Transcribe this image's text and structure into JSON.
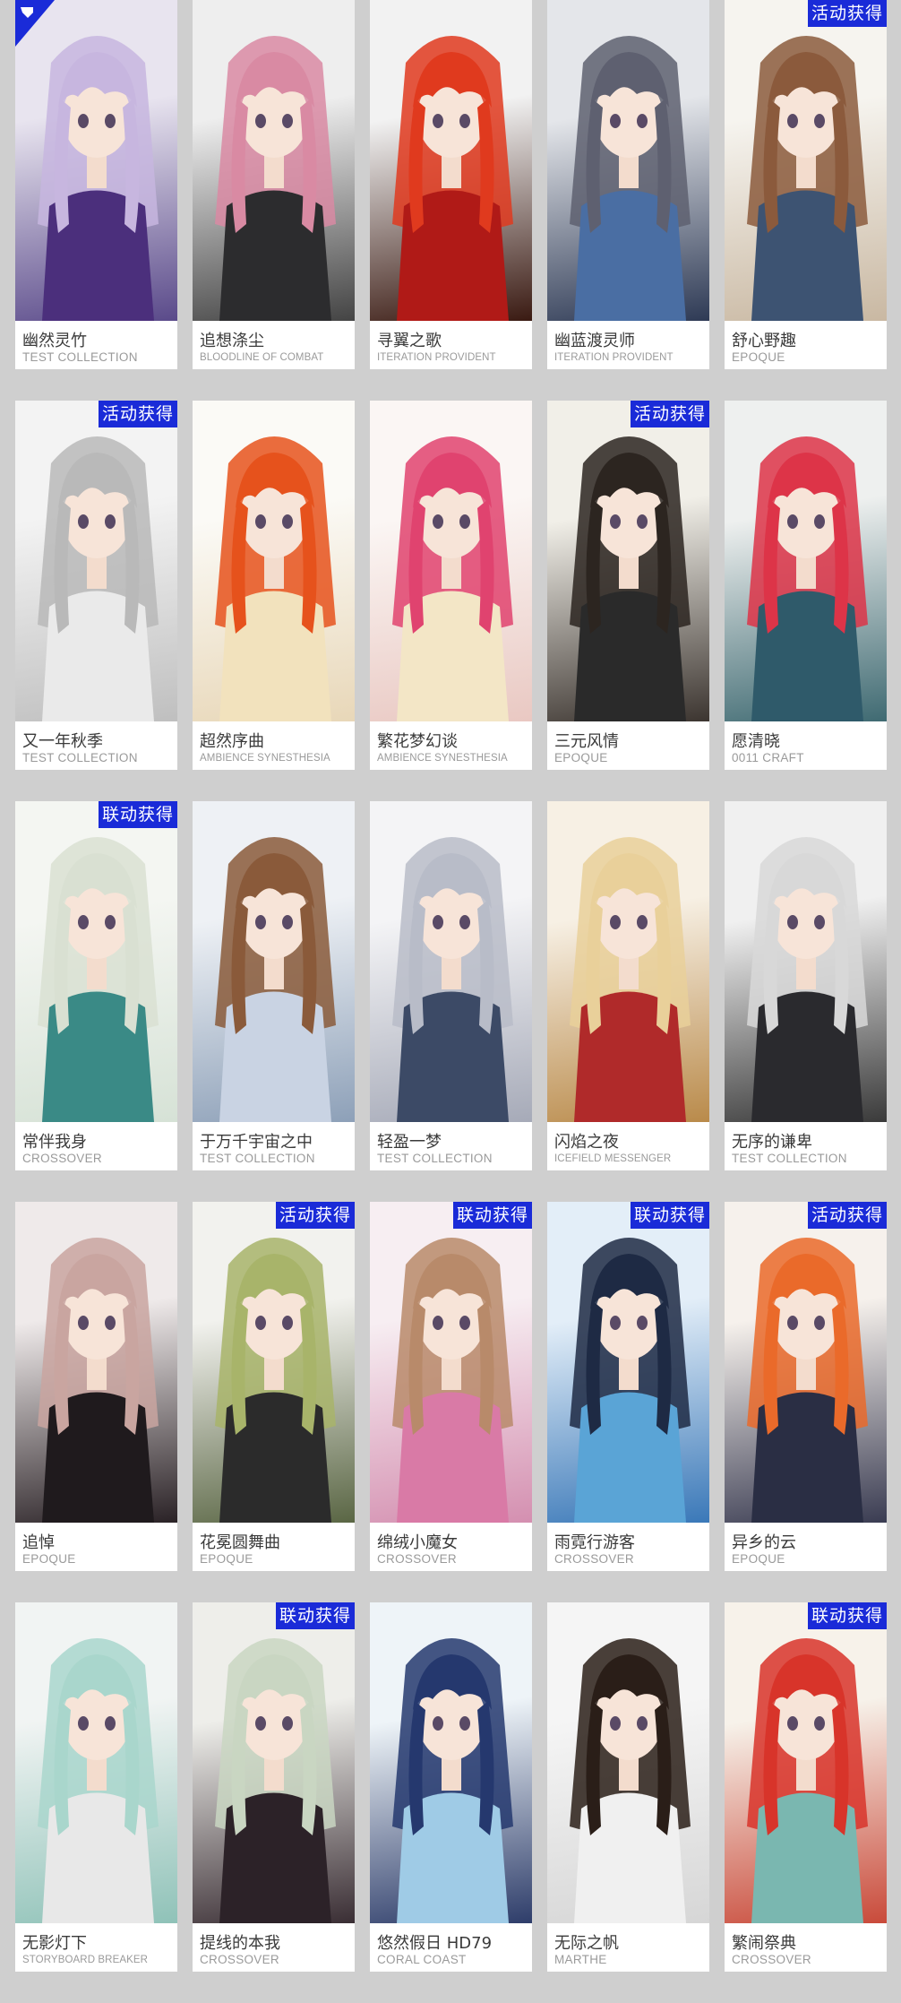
{
  "cards": [
    {
      "name": "幽然灵竹",
      "series": "TEST COLLECTION",
      "badge": "",
      "bg": [
        "#e8e4ef",
        "#5a4a8a"
      ],
      "hair": "#c7b6df",
      "outfit": "#4b2f7c",
      "corner_icon": "crest-icon"
    },
    {
      "name": "追想涤尘",
      "series": "BLOODLINE OF COMBAT",
      "badge": "",
      "bg": [
        "#eeeeee",
        "#444444"
      ],
      "hair": "#d98aa3",
      "outfit": "#2c2c2e"
    },
    {
      "name": "寻翼之歌",
      "series": "ITERATION PROVIDENT",
      "badge": "",
      "bg": [
        "#f2f2f2",
        "#3a1a12"
      ],
      "hair": "#e03a1e",
      "outfit": "#b01a17"
    },
    {
      "name": "幽蓝渡灵师",
      "series": "ITERATION PROVIDENT",
      "badge": "",
      "bg": [
        "#e4e6ea",
        "#2e3a55"
      ],
      "hair": "#5e6070",
      "outfit": "#4a6ea3"
    },
    {
      "name": "舒心野趣",
      "series": "EPOQUE",
      "badge": "活动获得",
      "bg": [
        "#f6f4ef",
        "#c9b8a2"
      ],
      "hair": "#8b5a3c",
      "outfit": "#3d5372"
    },
    {
      "name": "又一年秋季",
      "series": "TEST COLLECTION",
      "badge": "活动获得",
      "bg": [
        "#f3f3f3",
        "#bfbfbf"
      ],
      "hair": "#b9b9b9",
      "outfit": "#eaeaea"
    },
    {
      "name": "超然序曲",
      "series": "AMBIENCE SYNESTHESIA",
      "badge": "",
      "bg": [
        "#fbfaf6",
        "#e8d7b8"
      ],
      "hair": "#e6521c",
      "outfit": "#f2e2bd"
    },
    {
      "name": "繁花梦幻谈",
      "series": "AMBIENCE SYNESTHESIA",
      "badge": "",
      "bg": [
        "#fbf6f4",
        "#e9c8c2"
      ],
      "hair": "#e0436f",
      "outfit": "#f3e6c6"
    },
    {
      "name": "三元风情",
      "series": "EPOQUE",
      "badge": "活动获得",
      "bg": [
        "#f1efe8",
        "#3c3530"
      ],
      "hair": "#2c2520",
      "outfit": "#2a2a2a"
    },
    {
      "name": "愿清晓",
      "series": "0011 CRAFT",
      "badge": "",
      "bg": [
        "#eef0ef",
        "#3f6a72"
      ],
      "hair": "#dd3448",
      "outfit": "#2f5a6a"
    },
    {
      "name": "常伴我身",
      "series": "CROSSOVER",
      "badge": "联动获得",
      "bg": [
        "#f4f6f2",
        "#d6e2d6"
      ],
      "hair": "#d9e0d2",
      "outfit": "#3a8a86"
    },
    {
      "name": "于万千宇宙之中",
      "series": "TEST COLLECTION",
      "badge": "",
      "bg": [
        "#eef1f5",
        "#8da0b8"
      ],
      "hair": "#8a5a3a",
      "outfit": "#c9d3e3"
    },
    {
      "name": "轻盈一梦",
      "series": "TEST COLLECTION",
      "badge": "",
      "bg": [
        "#f4f4f6",
        "#a6aab8"
      ],
      "hair": "#b8bcc8",
      "outfit": "#3c4a66"
    },
    {
      "name": "闪焰之夜",
      "series": "ICEFIELD MESSENGER",
      "badge": "",
      "bg": [
        "#f7f0e4",
        "#b98a4a"
      ],
      "hair": "#e9d09a",
      "outfit": "#b02a2a"
    },
    {
      "name": "无序的谦卑",
      "series": "TEST COLLECTION",
      "badge": "",
      "bg": [
        "#f0f0f0",
        "#3a3a3a"
      ],
      "hair": "#d8d8d8",
      "outfit": "#2a2a2e"
    },
    {
      "name": "追悼",
      "series": "EPOQUE",
      "badge": "",
      "bg": [
        "#efeaea",
        "#2a2226"
      ],
      "hair": "#c9a5a0",
      "outfit": "#1f1a1d"
    },
    {
      "name": "花冕圆舞曲",
      "series": "EPOQUE",
      "badge": "活动获得",
      "bg": [
        "#f2f2ee",
        "#5a6644"
      ],
      "hair": "#a8b46a",
      "outfit": "#2b2b2b"
    },
    {
      "name": "绵绒小魔女",
      "series": "CROSSOVER",
      "badge": "联动获得",
      "bg": [
        "#f7eef2",
        "#d48fb0"
      ],
      "hair": "#b88a6a",
      "outfit": "#d97aa6"
    },
    {
      "name": "雨霓行游客",
      "series": "CROSSOVER",
      "badge": "联动获得",
      "bg": [
        "#e3eef8",
        "#3a78b8"
      ],
      "hair": "#1e2a44",
      "outfit": "#5aa4d6"
    },
    {
      "name": "异乡的云",
      "series": "EPOQUE",
      "badge": "活动获得",
      "bg": [
        "#f6f1ec",
        "#3a3c52"
      ],
      "hair": "#ea6a2a",
      "outfit": "#2a2e44"
    },
    {
      "name": "无影灯下",
      "series": "STORYBOARD BREAKER",
      "badge": "",
      "bg": [
        "#f1f4f3",
        "#8fc2b8"
      ],
      "hair": "#a9d6cc",
      "outfit": "#e8e8e8"
    },
    {
      "name": "提线的本我",
      "series": "CROSSOVER",
      "badge": "联动获得",
      "bg": [
        "#eeeeea",
        "#3a2e34"
      ],
      "hair": "#c9d6c2",
      "outfit": "#2c2228"
    },
    {
      "name": "悠然假日 HD79",
      "series": "CORAL COAST",
      "badge": "",
      "bg": [
        "#eef4f8",
        "#2e3d6a"
      ],
      "hair": "#25386e",
      "outfit": "#9fcbe6"
    },
    {
      "name": "无际之帆",
      "series": "MARTHE",
      "badge": "",
      "bg": [
        "#f5f5f5",
        "#d6d6d6"
      ],
      "hair": "#2a1e18",
      "outfit": "#f0f0f0"
    },
    {
      "name": "繁闹祭典",
      "series": "CROSSOVER",
      "badge": "联动获得",
      "bg": [
        "#f7f2ea",
        "#c94a3a"
      ],
      "hair": "#d8342a",
      "outfit": "#7ab7b0"
    }
  ]
}
